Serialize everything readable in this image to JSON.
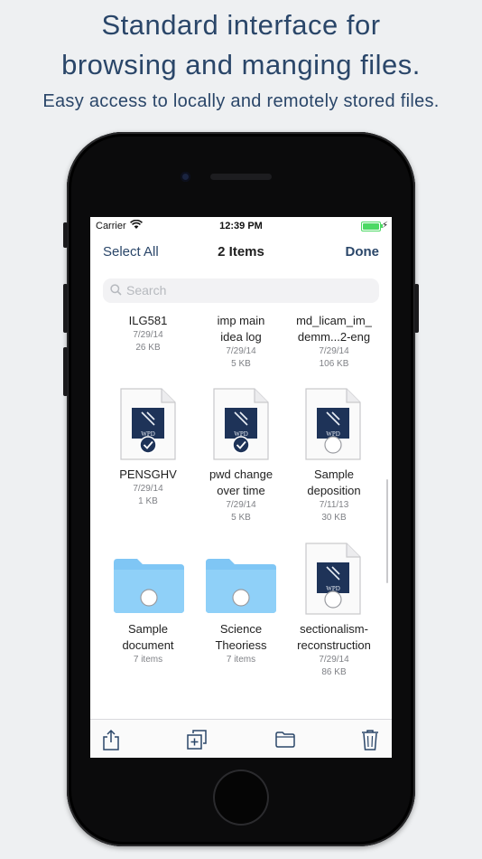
{
  "promo": {
    "headline_line1": "Standard interface for",
    "headline_line2": "browsing and manging files.",
    "subline": "Easy access to locally and remotely stored files."
  },
  "status_bar": {
    "carrier": "Carrier",
    "time": "12:39 PM",
    "battery_level": 1.0
  },
  "nav_bar": {
    "left_action": "Select All",
    "title": "2 Items",
    "right_action": "Done"
  },
  "search": {
    "placeholder": "Search"
  },
  "files": {
    "row1": [
      {
        "name_line1": "ILG581",
        "name_line2": "",
        "date": "7/29/14",
        "size": "26 KB"
      },
      {
        "name_line1": "imp main",
        "name_line2": "idea log",
        "date": "7/29/14",
        "size": "5 KB"
      },
      {
        "name_line1": "md_licam_im_",
        "name_line2": "demm...2-eng",
        "date": "7/29/14",
        "size": "106 KB"
      }
    ],
    "row2": [
      {
        "name_line1": "PENSGHV",
        "name_line2": "",
        "date": "7/29/14",
        "size": "1 KB",
        "selected": true
      },
      {
        "name_line1": "pwd change",
        "name_line2": "over time",
        "date": "7/29/14",
        "size": "5 KB",
        "selected": true
      },
      {
        "name_line1": "Sample",
        "name_line2": "deposition",
        "date": "7/11/13",
        "size": "30 KB",
        "selected": false
      }
    ],
    "row3": [
      {
        "name_line1": "Sample",
        "name_line2": "document",
        "count": "7 items",
        "kind": "folder"
      },
      {
        "name_line1": "Science",
        "name_line2": "Theoriess",
        "count": "7 items",
        "kind": "folder"
      },
      {
        "name_line1": "sectionalism-",
        "name_line2": "reconstruction",
        "date": "7/29/14",
        "size": "86 KB",
        "kind": "document"
      }
    ]
  },
  "doc_icon_badge": "WPD",
  "colors": {
    "accent": "#2a4669",
    "folder": "#7fc6f5",
    "doc_badge": "#1e3358",
    "battery": "#4cd964"
  },
  "toolbar": {
    "icons": [
      "share-icon",
      "duplicate-icon",
      "folder-icon",
      "trash-icon"
    ]
  }
}
